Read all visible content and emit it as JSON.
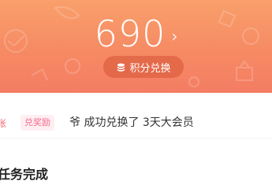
{
  "header": {
    "points": "690",
    "points_chevron": "›",
    "redeem_label": "积分兑换"
  },
  "ticker": {
    "prev_fragment": "张",
    "tag": "兑奖励",
    "text": "爷 成功兑换了 3天大会员"
  },
  "section": {
    "title": "任务完成"
  },
  "colors": {
    "hero_top": "#f9a06b",
    "hero_bottom": "#f47d63",
    "tag_text": "#f36b8d",
    "tag_bg": "#ffeef2"
  }
}
